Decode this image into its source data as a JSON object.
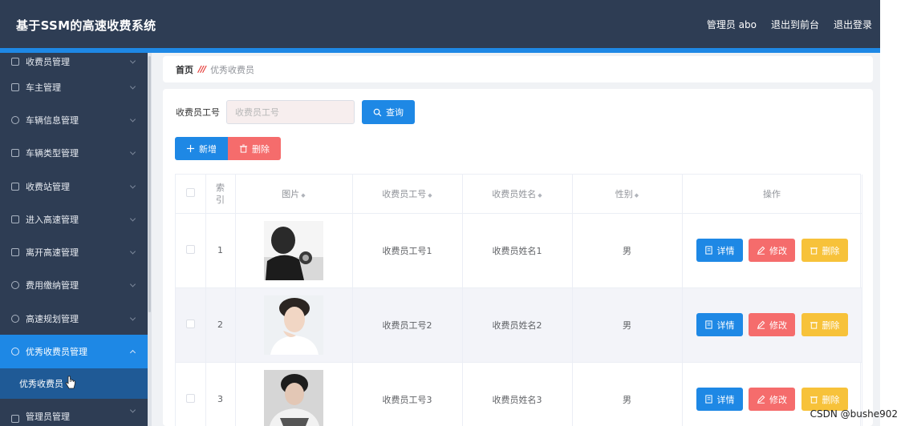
{
  "header": {
    "title": "基于SSM的高速收费系统",
    "user": "管理员 abo",
    "to_front": "退出到前台",
    "logout": "退出登录"
  },
  "sidebar": {
    "items": [
      {
        "label": "收费员管理"
      },
      {
        "label": "车主管理"
      },
      {
        "label": "车辆信息管理"
      },
      {
        "label": "车辆类型管理"
      },
      {
        "label": "收费站管理"
      },
      {
        "label": "进入高速管理"
      },
      {
        "label": "离开高速管理"
      },
      {
        "label": "费用缴纳管理"
      },
      {
        "label": "高速规划管理"
      },
      {
        "label": "优秀收费员管理"
      },
      {
        "label": "管理员管理"
      }
    ],
    "submenu": "优秀收费员"
  },
  "breadcrumb": {
    "home": "首页",
    "current": "优秀收费员"
  },
  "search": {
    "label": "收费员工号",
    "placeholder": "收费员工号",
    "button": "查询"
  },
  "actions": {
    "add": "新增",
    "delete": "删除"
  },
  "table": {
    "headers": {
      "index": "索引",
      "image": "图片",
      "staff_no": "收费员工号",
      "staff_name": "收费员姓名",
      "gender": "性别",
      "operation": "操作"
    },
    "rows": [
      {
        "index": "1",
        "staff_no": "收费员工号1",
        "staff_name": "收费员姓名1",
        "gender": "男"
      },
      {
        "index": "2",
        "staff_no": "收费员工号2",
        "staff_name": "收费员姓名2",
        "gender": "男"
      },
      {
        "index": "3",
        "staff_no": "收费员工号3",
        "staff_name": "收费员姓名3",
        "gender": "男"
      }
    ],
    "row_buttons": {
      "detail": "详情",
      "edit": "修改",
      "delete": "删除"
    }
  },
  "watermark": "CSDN @bushe902",
  "colors": {
    "header_bg": "#2e3d54",
    "accent": "#1e88e5",
    "danger": "#f56c6c",
    "warning": "#f7c23a"
  }
}
